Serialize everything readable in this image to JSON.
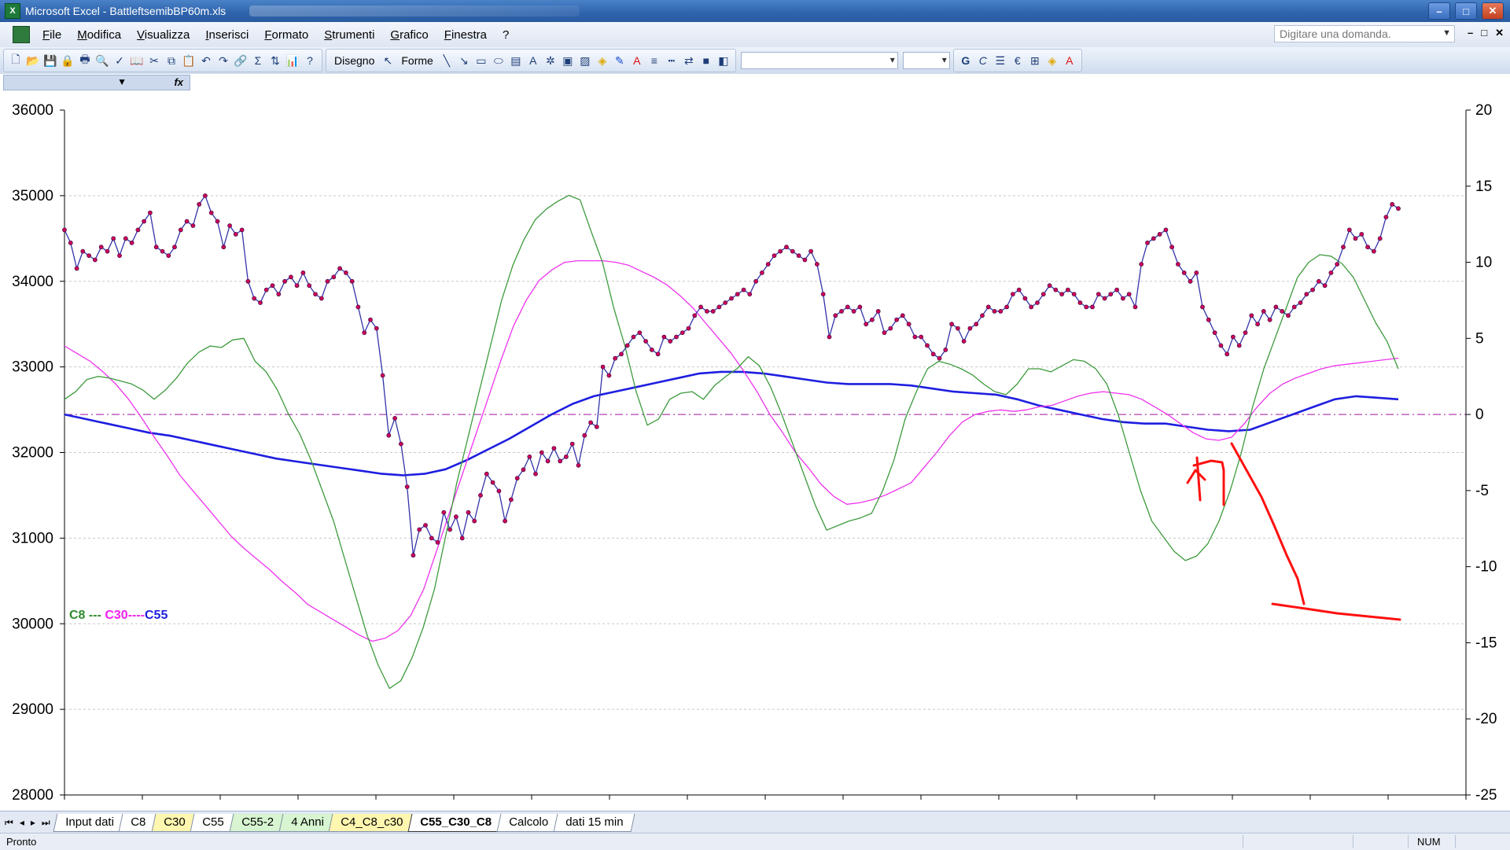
{
  "window": {
    "title": "Microsoft Excel - BattleftsemibBP60m.xls",
    "app_icon": "excel-icon",
    "minimize": "–",
    "maximize": "□",
    "close": "✕"
  },
  "menu": {
    "items": [
      "File",
      "Modifica",
      "Visualizza",
      "Inserisci",
      "Formato",
      "Strumenti",
      "Grafico",
      "Finestra",
      "?"
    ],
    "help_placeholder": "Digitare una domanda."
  },
  "toolbar": {
    "draw_label": "Disegno",
    "shapes_label": "Forme",
    "sigma": "Σ",
    "euro": "€",
    "bold_g": "G"
  },
  "formula": {
    "fx": "fx"
  },
  "chart_data": {
    "type": "line",
    "legend": {
      "c8": "C8",
      "c30": "C30",
      "c55": "C55",
      "sep1": " --- ",
      "sep2": "----"
    },
    "colors": {
      "price": "#3333aa",
      "price_marker": "#cc0055",
      "c8": "#3c9a3c",
      "c30": "#ee33ee",
      "c55": "#1e1ee0",
      "zero": "#b040b0",
      "annotation": "#ff1010"
    },
    "y_left": {
      "ticks": [
        36000,
        35000,
        34000,
        33000,
        32000,
        31000,
        30000,
        29000,
        28000
      ],
      "range": [
        28000,
        36000
      ]
    },
    "y_right": {
      "ticks": [
        20,
        15,
        10,
        5,
        0,
        -5,
        -10,
        -15,
        -20,
        -25
      ],
      "range": [
        -25,
        20
      ]
    },
    "grid": true,
    "series": [
      {
        "name": "price",
        "axis": "left",
        "values": [
          34600,
          34450,
          34150,
          34350,
          34300,
          34250,
          34400,
          34350,
          34500,
          34300,
          34500,
          34450,
          34600,
          34700,
          34800,
          34400,
          34350,
          34300,
          34400,
          34600,
          34700,
          34650,
          34900,
          35000,
          34800,
          34700,
          34400,
          34650,
          34550,
          34600,
          34000,
          33800,
          33750,
          33900,
          33950,
          33850,
          34000,
          34050,
          33950,
          34100,
          33950,
          33850,
          33800,
          34000,
          34050,
          34150,
          34100,
          34000,
          33700,
          33400,
          33550,
          33450,
          32900,
          32200,
          32400,
          32100,
          31600,
          30800,
          31100,
          31150,
          31000,
          30950,
          31300,
          31100,
          31250,
          31000,
          31300,
          31200,
          31500,
          31750,
          31650,
          31550,
          31200,
          31450,
          31700,
          31800,
          31950,
          31750,
          32000,
          31900,
          32050,
          31900,
          31950,
          32100,
          31850,
          32200,
          32350,
          32300,
          33000,
          32900,
          33100,
          33150,
          33250,
          33350,
          33400,
          33300,
          33200,
          33150,
          33350,
          33300,
          33350,
          33400,
          33450,
          33600,
          33700,
          33650,
          33650,
          33700,
          33750,
          33800,
          33850,
          33900,
          33850,
          34000,
          34100,
          34200,
          34300,
          34350,
          34400,
          34350,
          34300,
          34250,
          34350,
          34200,
          33850,
          33350,
          33600,
          33650,
          33700,
          33650,
          33700,
          33500,
          33550,
          33650,
          33400,
          33450,
          33550,
          33600,
          33500,
          33350,
          33350,
          33250,
          33150,
          33100,
          33200,
          33500,
          33450,
          33300,
          33450,
          33500,
          33600,
          33700,
          33650,
          33650,
          33700,
          33850,
          33900,
          33800,
          33700,
          33750,
          33850,
          33950,
          33900,
          33850,
          33900,
          33850,
          33750,
          33700,
          33700,
          33850,
          33800,
          33850,
          33900,
          33800,
          33850,
          33700,
          34200,
          34450,
          34500,
          34550,
          34600,
          34400,
          34200,
          34100,
          34000,
          34100,
          33700,
          33550,
          33400,
          33250,
          33150,
          33350,
          33250,
          33400,
          33600,
          33500,
          33650,
          33550,
          33700,
          33650,
          33600,
          33700,
          33750,
          33850,
          33900,
          34000,
          33950,
          34100,
          34200,
          34400,
          34600,
          34500,
          34550,
          34400,
          34350,
          34500,
          34750,
          34900,
          34850
        ]
      },
      {
        "name": "C8",
        "axis": "right",
        "values": [
          1,
          1.5,
          2.3,
          2.5,
          2.4,
          2.2,
          2.0,
          1.6,
          1.0,
          1.6,
          2.4,
          3.4,
          4.1,
          4.5,
          4.4,
          4.9,
          5.0,
          3.5,
          2.8,
          1.6,
          0.0,
          -1.3,
          -3.0,
          -5.0,
          -7.0,
          -9.5,
          -12.0,
          -14.5,
          -16.5,
          -18.0,
          -17.5,
          -16.0,
          -14.0,
          -11.5,
          -8.0,
          -4.5,
          -1.5,
          1.5,
          4.5,
          7.5,
          9.8,
          11.5,
          12.8,
          13.5,
          14.0,
          14.4,
          14.1,
          12.0,
          10.0,
          7.0,
          4.5,
          1.5,
          -0.7,
          -0.3,
          1.0,
          1.4,
          1.5,
          1.0,
          1.9,
          2.5,
          3.0,
          3.8,
          3.2,
          1.8,
          0.0,
          -2.0,
          -4.0,
          -6.0,
          -7.6,
          -7.3,
          -7.0,
          -6.8,
          -6.5,
          -5.0,
          -3.0,
          -0.3,
          1.5,
          3.0,
          3.5,
          3.3,
          3.0,
          2.6,
          2.0,
          1.5,
          1.3,
          2.0,
          3.0,
          3.0,
          2.8,
          3.2,
          3.6,
          3.5,
          3.0,
          2.0,
          0.0,
          -2.5,
          -5.0,
          -7.0,
          -8.0,
          -9.0,
          -9.6,
          -9.3,
          -8.5,
          -7.0,
          -5.0,
          -2.5,
          0.5,
          3.0,
          5.0,
          7.0,
          9.0,
          10.0,
          10.5,
          10.4,
          9.9,
          9.0,
          7.5,
          6.0,
          4.8,
          3.0
        ]
      },
      {
        "name": "C30",
        "axis": "right",
        "values": [
          4.5,
          4.0,
          3.5,
          2.8,
          2.0,
          1.0,
          -0.2,
          -1.5,
          -2.7,
          -4.0,
          -5.0,
          -6.0,
          -7.0,
          -8.0,
          -8.8,
          -9.5,
          -10.2,
          -11.0,
          -11.7,
          -12.5,
          -13.0,
          -13.5,
          -14.0,
          -14.5,
          -14.9,
          -14.7,
          -14.2,
          -13.2,
          -11.5,
          -9.0,
          -6.5,
          -4.0,
          -1.5,
          1.0,
          3.5,
          5.8,
          7.5,
          8.8,
          9.5,
          10.0,
          10.1,
          10.1,
          10.1,
          10.0,
          9.8,
          9.4,
          9.0,
          8.5,
          7.8,
          7.0,
          6.0,
          5.0,
          4.0,
          2.8,
          1.5,
          0.0,
          -1.2,
          -2.5,
          -3.5,
          -4.6,
          -5.4,
          -5.9,
          -5.8,
          -5.6,
          -5.3,
          -4.9,
          -4.5,
          -3.5,
          -2.5,
          -1.4,
          -0.5,
          0.0,
          0.2,
          0.3,
          0.2,
          0.3,
          0.5,
          0.6,
          0.9,
          1.2,
          1.4,
          1.5,
          1.4,
          1.3,
          1.0,
          0.5,
          0.0,
          -0.6,
          -1.2,
          -1.6,
          -1.7,
          -1.5,
          -0.6,
          0.5,
          1.4,
          2.0,
          2.4,
          2.7,
          3.0,
          3.2,
          3.3,
          3.4,
          3.5,
          3.6,
          3.7
        ]
      },
      {
        "name": "C55",
        "axis": "right",
        "values": [
          0.0,
          -0.3,
          -0.6,
          -0.9,
          -1.2,
          -1.4,
          -1.7,
          -2.0,
          -2.3,
          -2.6,
          -2.9,
          -3.1,
          -3.3,
          -3.5,
          -3.7,
          -3.9,
          -4.0,
          -3.9,
          -3.6,
          -3.0,
          -2.3,
          -1.6,
          -0.8,
          0.0,
          0.7,
          1.2,
          1.5,
          1.8,
          2.1,
          2.4,
          2.7,
          2.8,
          2.8,
          2.7,
          2.5,
          2.3,
          2.1,
          2.0,
          2.0,
          2.0,
          1.9,
          1.7,
          1.5,
          1.4,
          1.3,
          1.0,
          0.6,
          0.3,
          0.0,
          -0.3,
          -0.5,
          -0.6,
          -0.6,
          -0.8,
          -1.0,
          -1.1,
          -1.0,
          -0.5,
          0.0,
          0.5,
          1.0,
          1.2,
          1.1,
          1.0
        ]
      }
    ]
  },
  "sheets": {
    "tabs": [
      {
        "label": "Input dati",
        "style": "white"
      },
      {
        "label": "C8",
        "style": "white"
      },
      {
        "label": "C30",
        "style": "yellow"
      },
      {
        "label": "C55",
        "style": "white"
      },
      {
        "label": "C55-2",
        "style": "green"
      },
      {
        "label": "4 Anni",
        "style": "green"
      },
      {
        "label": "C4_C8_c30",
        "style": "yellow"
      },
      {
        "label": "C55_C30_C8",
        "style": "active"
      },
      {
        "label": "Calcolo",
        "style": "white"
      },
      {
        "label": "dati 15 min",
        "style": "white"
      }
    ],
    "nav": [
      "⏮",
      "◂",
      "▸",
      "⏭"
    ]
  },
  "status": {
    "text": "Pronto",
    "num": "NUM"
  }
}
